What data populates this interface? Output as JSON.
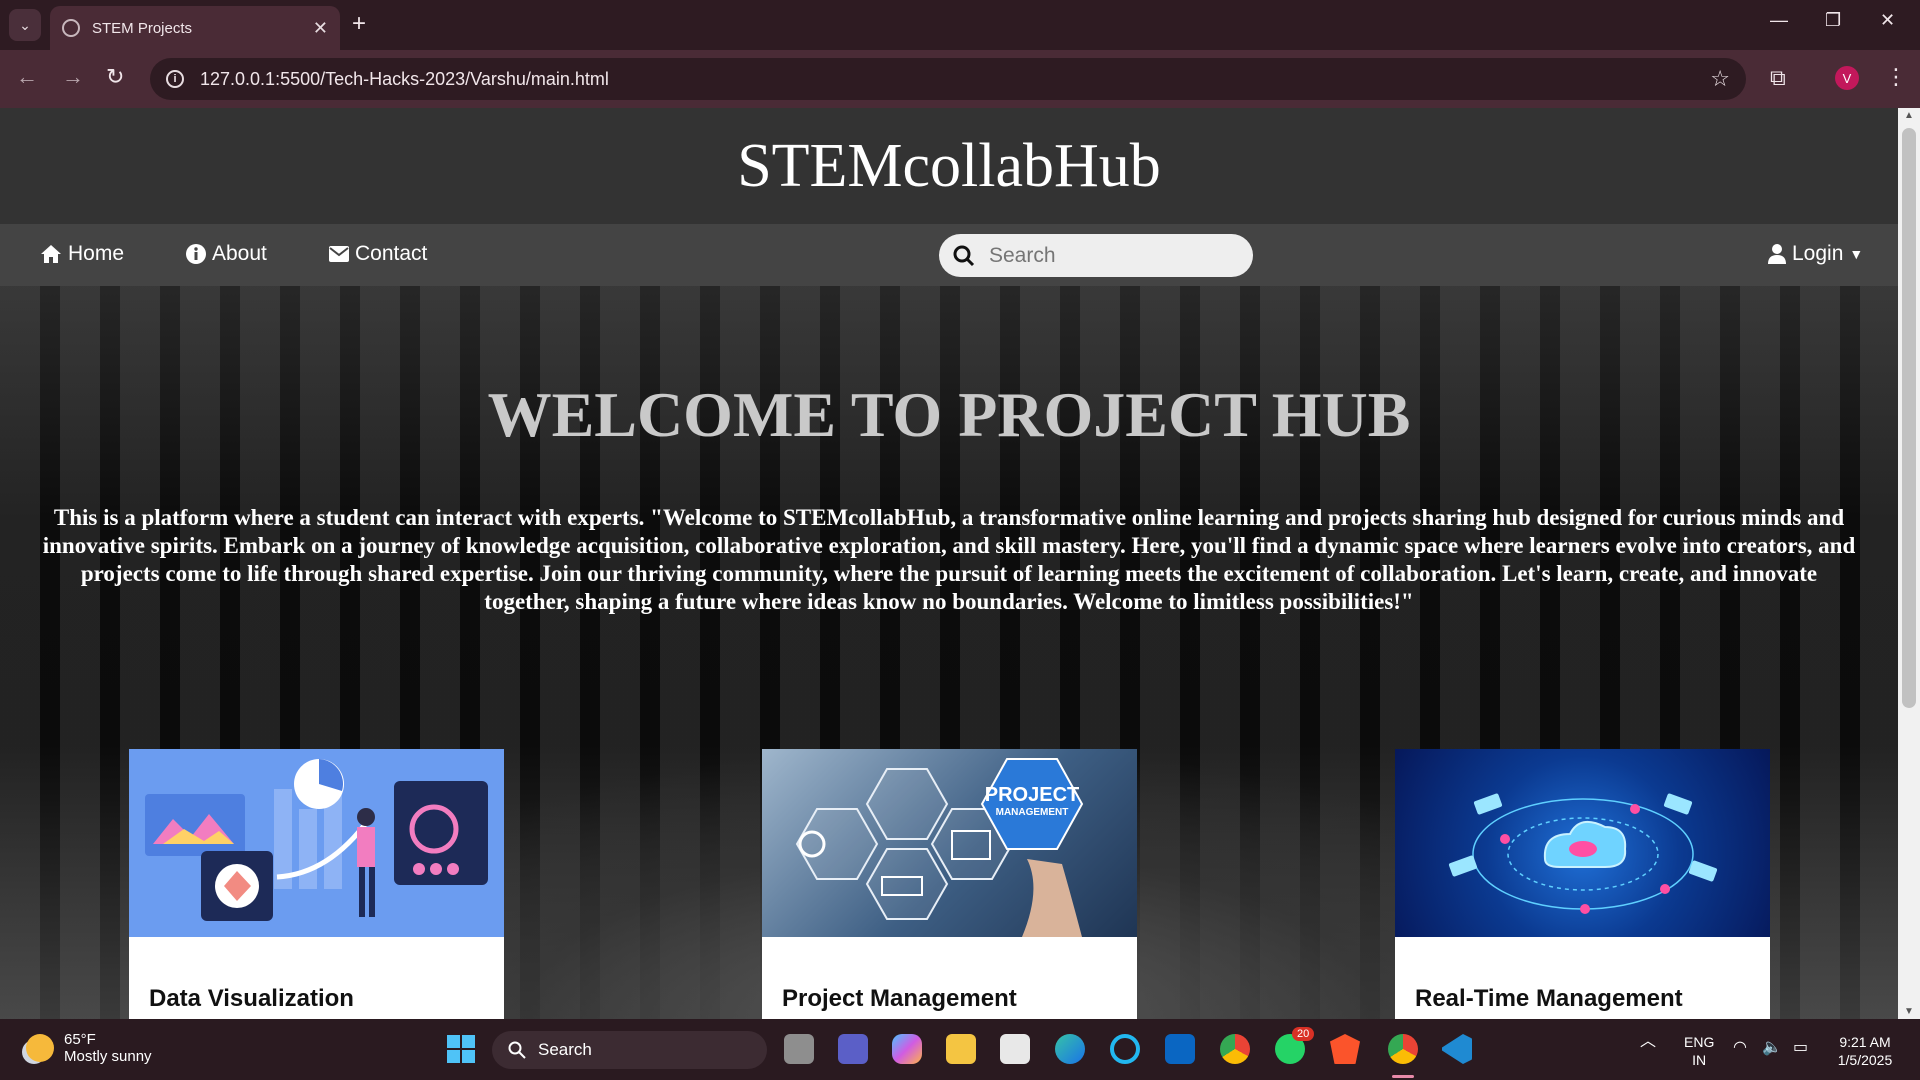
{
  "browser": {
    "tab_title": "STEM Projects",
    "url": "127.0.0.1:5500/Tech-Hacks-2023/Varshu/main.html",
    "profile_initial": "V"
  },
  "site": {
    "brand": "STEMcollabHub",
    "nav": {
      "home": "Home",
      "about": "About",
      "contact": "Contact",
      "search_placeholder": "Search",
      "login": "Login"
    },
    "hero": {
      "title": "WELCOME TO PROJECT HUB",
      "text": "This is a platform where a student can interact with experts. \"Welcome to STEMcollabHub, a transformative online learning and projects sharing hub designed for curious minds and innovative spirits. Embark on a journey of knowledge acquisition, collaborative exploration, and skill mastery. Here, you'll find a dynamic space where learners evolve into creators, and projects come to life through shared expertise. Join our thriving community, where the pursuit of learning meets the excitement of collaboration. Let's learn, create, and innovate together, shaping a future where ideas know no boundaries. Welcome to limitless possibilities!\""
    },
    "cards": [
      {
        "title": "Data Visualization",
        "image_alt": "data-visualization-illustration"
      },
      {
        "title": "Project Management",
        "image_alt": "project-management-hexagons",
        "image_caption": "PROJECT MANAGEMENT"
      },
      {
        "title": "Real-Time Management",
        "image_alt": "cloud-network-illustration"
      }
    ]
  },
  "taskbar": {
    "weather_temp": "65°F",
    "weather_desc": "Mostly sunny",
    "search_label": "Search",
    "whatsapp_badge": "20",
    "lang_1": "ENG",
    "lang_2": "IN",
    "time": "9:21 AM",
    "date": "1/5/2025"
  }
}
